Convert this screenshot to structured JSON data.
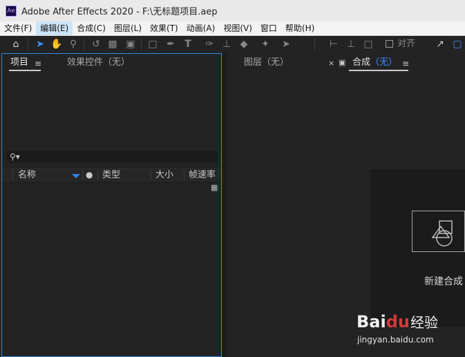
{
  "app": {
    "logo": "Ae",
    "title": "Adobe After Effects 2020 - F:\\无标题项目.aep"
  },
  "menu": [
    "文件(F)",
    "编辑(E)",
    "合成(C)",
    "图层(L)",
    "效果(T)",
    "动画(A)",
    "视图(V)",
    "窗口",
    "帮助(H)"
  ],
  "toolbar": {
    "icons": [
      "home-icon",
      "selection-tool-icon",
      "hand-tool-icon",
      "zoom-tool-icon",
      "rotate-tool-icon",
      "camera-tool-icon",
      "pan-behind-tool-icon",
      "rectangle-tool-icon",
      "pen-tool-icon",
      "type-tool-icon",
      "brush-tool-icon",
      "clone-stamp-tool-icon",
      "eraser-tool-icon",
      "roto-brush-tool-icon",
      "puppet-pin-tool-icon",
      "axis-local-icon",
      "axis-world-icon",
      "axis-view-icon",
      "expand-icon",
      "workspace-icon"
    ],
    "snap_label": "对齐"
  },
  "left_panel": {
    "tabs": [
      "项目",
      "效果控件（无）"
    ],
    "columns": [
      "名称",
      "类型",
      "大小",
      "帧速率"
    ]
  },
  "right_panel": {
    "tabs": [
      "图层（无）",
      "合成"
    ],
    "comp_tab_suffix": "（无）",
    "new_comp_label": "新建合成"
  },
  "watermark": {
    "logo_a": "Bai",
    "logo_b": "du",
    "logo_c": "经验",
    "url": "jingyan.baidu.com"
  },
  "colors": {
    "accent": "#2d8ceb",
    "panel_bg": "#232323",
    "titlebar_bg": "#e9e9e9"
  }
}
